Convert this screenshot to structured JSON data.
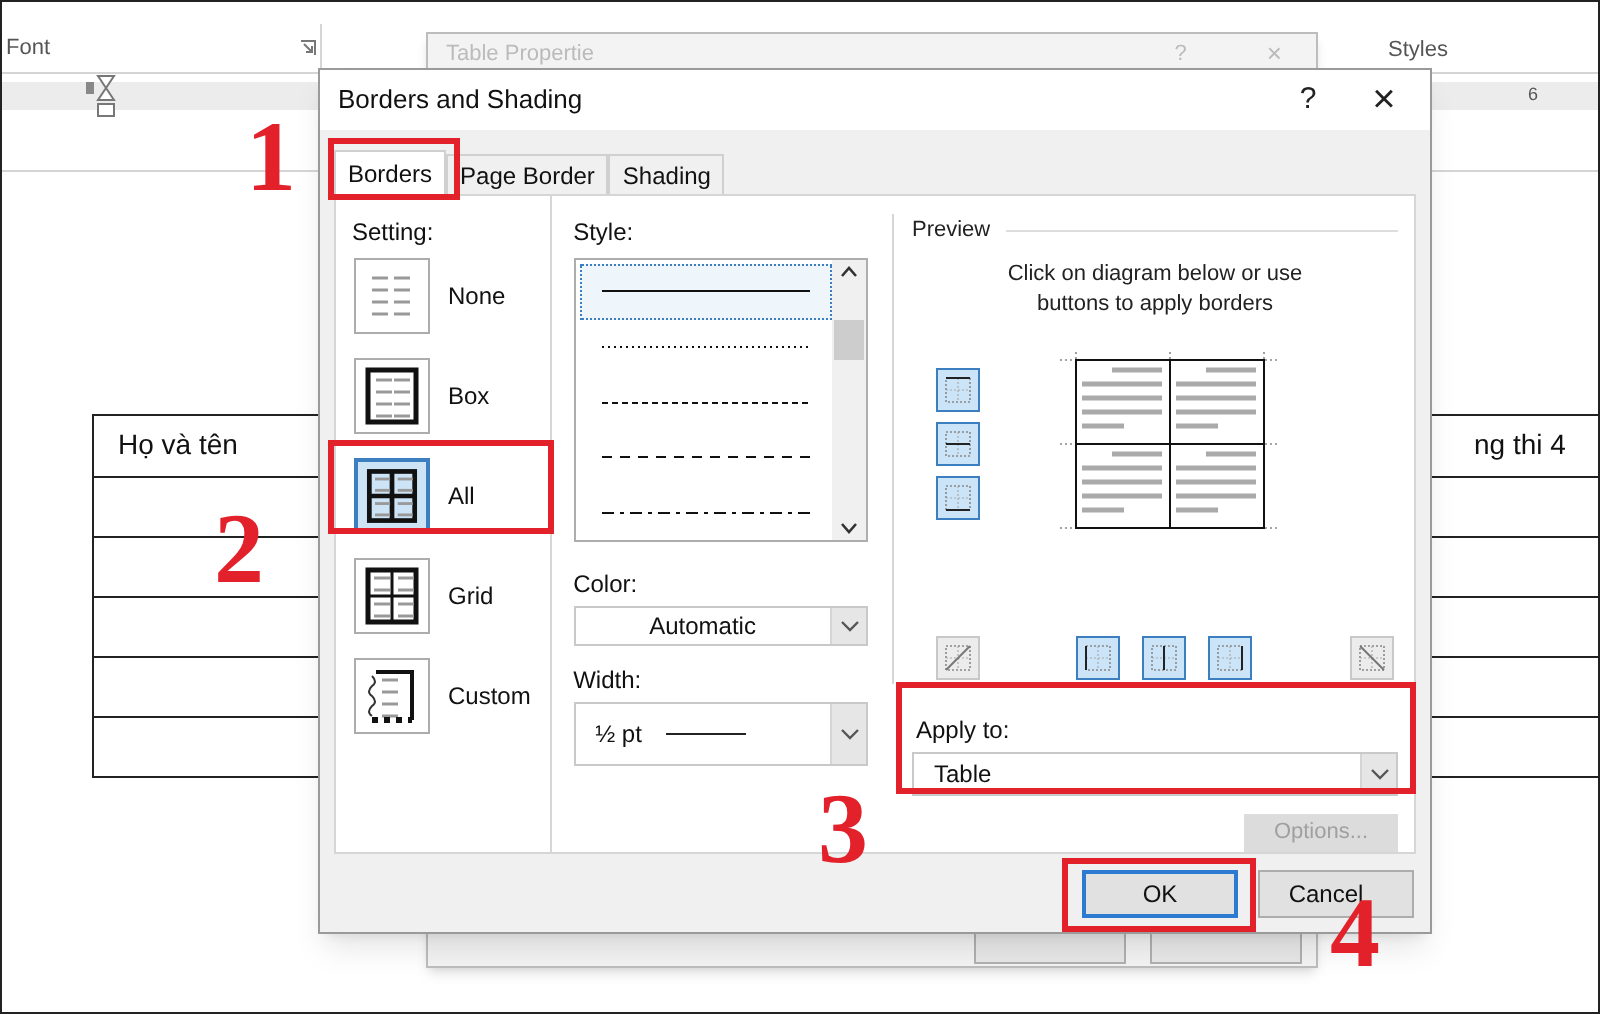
{
  "ribbon": {
    "groups": [
      "Font",
      "Styles"
    ],
    "ruler_number": "6"
  },
  "table": {
    "header": [
      "Họ và tên",
      "ng thi 4"
    ]
  },
  "back_dialog": {
    "title": "Table Propertie",
    "help": "?",
    "close": "×"
  },
  "dialog": {
    "title": "Borders and Shading",
    "help": "?",
    "close": "×",
    "tabs": [
      {
        "label": "Borders",
        "selected": true
      },
      {
        "label": "Page Border",
        "selected": false
      },
      {
        "label": "Shading",
        "selected": false
      }
    ],
    "setting": {
      "label": "Setting:",
      "options": [
        {
          "label": "None",
          "kind": "none",
          "selected": false
        },
        {
          "label": "Box",
          "kind": "box",
          "selected": false
        },
        {
          "label": "All",
          "kind": "all",
          "selected": true
        },
        {
          "label": "Grid",
          "kind": "grid",
          "selected": false
        },
        {
          "label": "Custom",
          "kind": "custom",
          "selected": false
        }
      ]
    },
    "style": {
      "label": "Style:",
      "lines": [
        {
          "kind": "solid",
          "selected": true
        },
        {
          "kind": "dotted",
          "selected": false
        },
        {
          "kind": "dashed",
          "selected": false
        },
        {
          "kind": "long-dashed",
          "selected": false
        },
        {
          "kind": "dash-dot",
          "selected": false
        }
      ]
    },
    "color": {
      "label": "Color:",
      "value": "Automatic"
    },
    "width": {
      "label": "Width:",
      "value": "½ pt"
    },
    "preview": {
      "label": "Preview",
      "hint": "Click on diagram below or use buttons to apply borders",
      "side_buttons": [
        {
          "kind": "top",
          "on": true
        },
        {
          "kind": "middle",
          "on": true
        },
        {
          "kind": "bottom",
          "on": true
        }
      ],
      "bottom_buttons": [
        {
          "kind": "diag-up",
          "on": false
        },
        {
          "kind": "left",
          "on": true
        },
        {
          "kind": "center",
          "on": true
        },
        {
          "kind": "right",
          "on": true
        },
        {
          "kind": "diag-down",
          "on": false
        }
      ]
    },
    "apply_to": {
      "label": "Apply to:",
      "value": "Table"
    },
    "options_button": {
      "label": "Options...",
      "disabled": true
    },
    "ok_button": {
      "label": "OK"
    },
    "cancel_button": {
      "label": "Cancel"
    }
  },
  "annotations": [
    {
      "label": "1"
    },
    {
      "label": "2"
    },
    {
      "label": "3"
    },
    {
      "label": "4"
    }
  ]
}
